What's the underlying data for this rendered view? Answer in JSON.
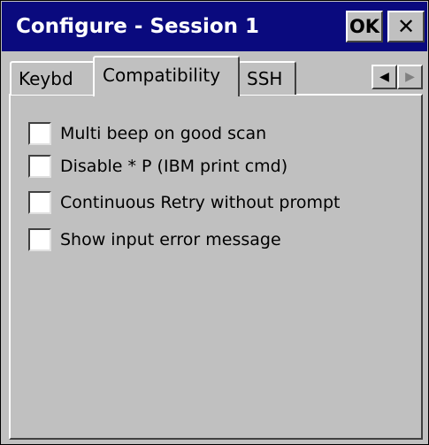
{
  "window": {
    "title": "Configure - Session 1",
    "ok_label": "OK",
    "close_label": "✕"
  },
  "tabs": [
    {
      "label": "Keybd",
      "selected": false
    },
    {
      "label": "Compatibility",
      "selected": true
    },
    {
      "label": "SSH",
      "selected": false
    }
  ],
  "tab_scroll": {
    "left_glyph": "◀",
    "right_glyph": "▶"
  },
  "options": [
    {
      "label": "Multi beep on good scan",
      "checked": false
    },
    {
      "label": "Disable * P (IBM print cmd)",
      "checked": false
    },
    {
      "label": "Continuous Retry without prompt",
      "checked": false
    },
    {
      "label": "Show input error message",
      "checked": false
    }
  ],
  "colors": {
    "titlebar": "#0a0a7e",
    "face": "#c0c0c0"
  }
}
